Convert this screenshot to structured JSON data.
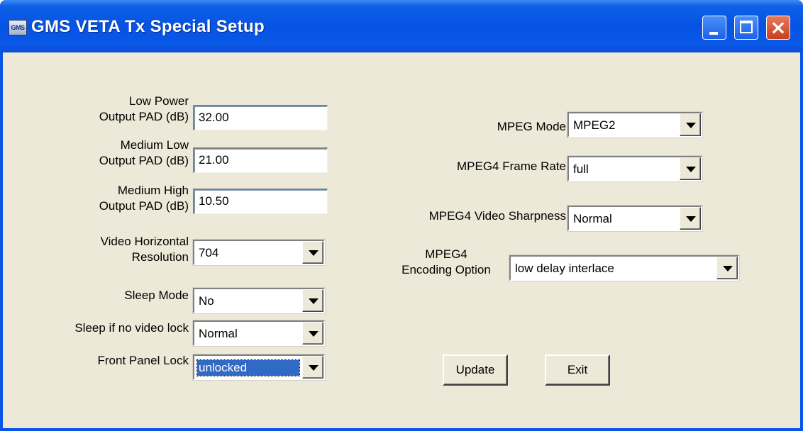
{
  "window": {
    "title": "GMS VETA Tx Special Setup",
    "icon_text": "GMS"
  },
  "left": {
    "low_power": {
      "label": "Low Power\nOutput PAD (dB)",
      "value": "32.00"
    },
    "medium_low": {
      "label": "Medium Low\nOutput PAD (dB)",
      "value": "21.00"
    },
    "medium_high": {
      "label": "Medium High\nOutput PAD (dB)",
      "value": "10.50"
    },
    "video_h_res": {
      "label": "Video Horizontal\nResolution",
      "value": "704"
    },
    "sleep_mode": {
      "label": "Sleep Mode",
      "value": "No"
    },
    "sleep_no_lock": {
      "label": "Sleep if no video lock",
      "value": "Normal"
    },
    "front_panel_lock": {
      "label": "Front Panel Lock",
      "value": "unlocked"
    }
  },
  "right": {
    "mpeg_mode": {
      "label": "MPEG Mode",
      "value": "MPEG2"
    },
    "mpeg4_frame_rate": {
      "label": "MPEG4 Frame Rate",
      "value": "full"
    },
    "mpeg4_sharpness": {
      "label": "MPEG4 Video Sharpness",
      "value": "Normal"
    },
    "mpeg4_encoding": {
      "label": "MPEG4\nEncoding Option",
      "value": "low delay interlace"
    }
  },
  "buttons": {
    "update": "Update",
    "exit": "Exit"
  },
  "colors": {
    "titlebar": "#0a55e8",
    "client_bg": "#ece9d8",
    "selection": "#316ac5",
    "close_button": "#d0502b"
  }
}
